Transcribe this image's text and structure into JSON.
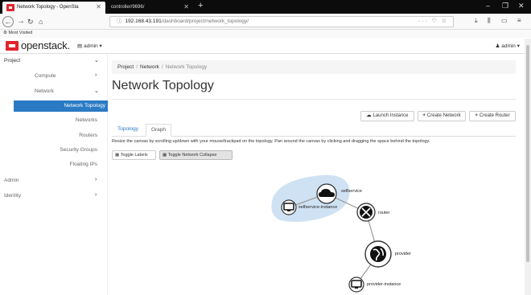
{
  "browser": {
    "active_tab": "Network Topology - OpenSta",
    "inactive_tab": "controller/9696/",
    "url_host": "192.168.43.191",
    "url_path": "/dashboard/project/network_topology/",
    "bookmark": "Most Visited"
  },
  "header": {
    "brand": "openstack.",
    "project": "admin ▾",
    "user": "admin ▾"
  },
  "sidebar": {
    "project": "Project",
    "compute": "Compute",
    "network": "Network",
    "network_topology": "Network Topology",
    "networks": "Networks",
    "routers": "Routers",
    "security_groups": "Security Groups",
    "floating_ips": "Floating IPs",
    "admin": "Admin",
    "identity": "Identity"
  },
  "breadcrumb": [
    "Project",
    "Network",
    "Network Topology"
  ],
  "page_title": "Network Topology",
  "actions": {
    "launch_instance": "Launch Instance",
    "create_network": "Create Network",
    "create_router": "Create Router"
  },
  "tabs": {
    "topology": "Topology",
    "graph": "Graph"
  },
  "help_text": "Resize the canvas by scrolling up/down with your mouse/trackpad on the topology. Pan around the canvas by clicking and dragging the space behind the topology.",
  "toggles": {
    "labels": "Toggle Labels",
    "collapse": "Toggle Network Collapse"
  },
  "topology": {
    "nodes": {
      "selfservice": "selfservice",
      "selfservice_instance": "selfservice-instance",
      "router": "router",
      "provider": "provider",
      "provider_instance": "provider-instance"
    },
    "highlight_color": "#cfe2f3"
  },
  "colors": {
    "accent": "#2a7bc4",
    "brand_red": "#e0242b"
  }
}
